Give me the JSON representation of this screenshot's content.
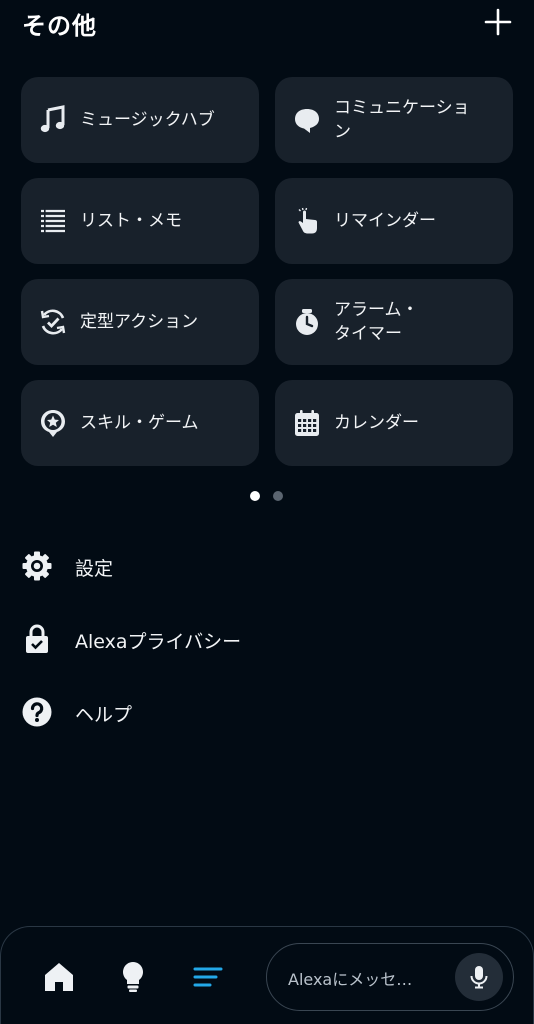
{
  "header": {
    "title": "その他"
  },
  "tiles": [
    {
      "label": "ミュージックハブ",
      "icon": "music-note-icon"
    },
    {
      "label": "コミュニケーショ\nン",
      "icon": "speech-bubble-icon"
    },
    {
      "label": "リスト・メモ",
      "icon": "list-icon"
    },
    {
      "label": "リマインダー",
      "icon": "reminder-hand-icon"
    },
    {
      "label": "定型アクション",
      "icon": "routine-check-icon"
    },
    {
      "label": "アラーム・\nタイマー",
      "icon": "alarm-clock-icon"
    },
    {
      "label": "スキル・ゲーム",
      "icon": "skill-star-icon"
    },
    {
      "label": "カレンダー",
      "icon": "calendar-icon"
    }
  ],
  "pager": {
    "count": 2,
    "active": 1
  },
  "menu": [
    {
      "label": "設定",
      "icon": "gear-icon"
    },
    {
      "label": "Alexaプライバシー",
      "icon": "privacy-lock-icon"
    },
    {
      "label": "ヘルプ",
      "icon": "help-icon"
    }
  ],
  "bottom_nav": {
    "items": [
      {
        "icon": "home-icon"
      },
      {
        "icon": "devices-bulb-icon"
      },
      {
        "icon": "more-menu-icon",
        "active": true
      }
    ],
    "message_placeholder": "Alexaにメッセ…",
    "mic_icon": "microphone-icon"
  },
  "colors": {
    "background": "#020b14",
    "tile": "#18212b",
    "accent": "#23a8e8",
    "text": "#f2f4f6"
  }
}
